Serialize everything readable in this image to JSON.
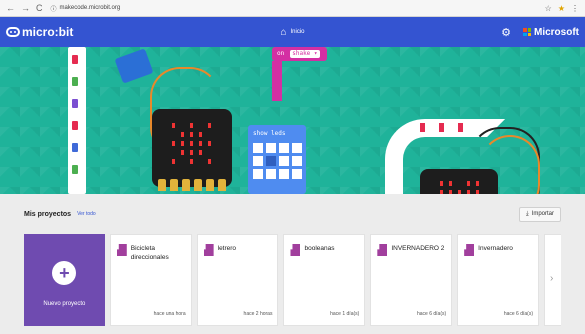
{
  "browser": {
    "back": "←",
    "forward": "→",
    "reload": "C",
    "lock": "ⓘ",
    "url": "makecode.microbit.org",
    "ext_icons": [
      "☆",
      "★",
      "⋮"
    ]
  },
  "appbar": {
    "brand": "micro:bit",
    "home_label": "Inicio",
    "org": "Microsoft",
    "colors": {
      "bar": "#3454d1"
    }
  },
  "hero": {
    "block_on": "on",
    "block_event": "shake ▾",
    "block_show": "show leds"
  },
  "projects": {
    "heading": "Mis proyectos",
    "view_all": "Ver todo",
    "import_label": "Importar",
    "new_project": "Nuevo proyecto",
    "items": [
      {
        "name": "Bicicleta direccionales",
        "time": "hace una hora"
      },
      {
        "name": "letrero",
        "time": "hace 2 horas"
      },
      {
        "name": "booleanas",
        "time": "hace 1 día(s)"
      },
      {
        "name": "INVERNADERO 2",
        "time": "hace 6 día(s)"
      },
      {
        "name": "Invernadero",
        "time": "hace 6 día(s)"
      }
    ]
  }
}
